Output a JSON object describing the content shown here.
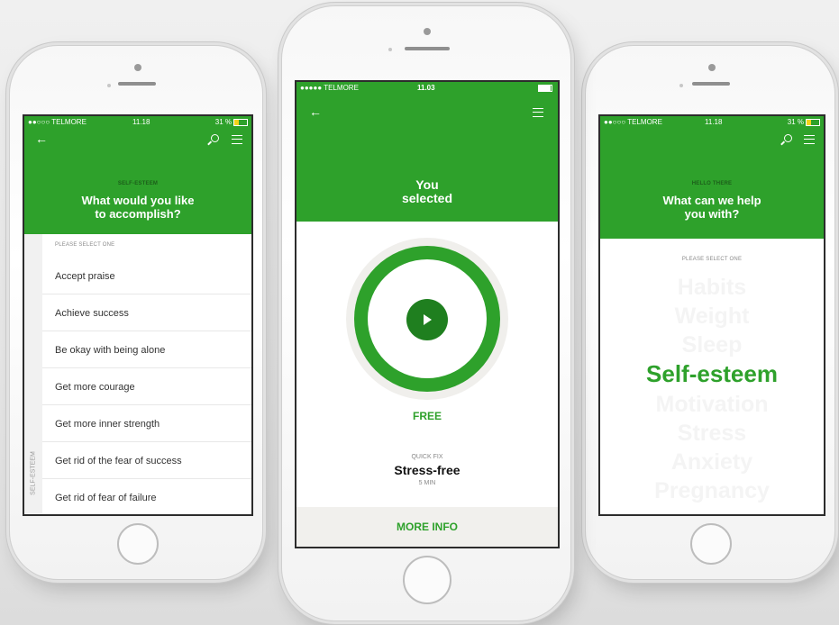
{
  "colors": {
    "brand_green": "#2ea12b",
    "dark_green": "#1f7f1f",
    "faded_word": "#f4f4f4"
  },
  "left_phone": {
    "status": {
      "carrier": "●●○○○ TELMORE",
      "time": "11.18",
      "battery": "31 %"
    },
    "icons": {
      "back": "back-arrow-icon",
      "search": "search-icon",
      "menu": "menu-icon"
    },
    "category": "SELF-ESTEEM",
    "title_line1": "What would you like",
    "title_line2": "to accomplish?",
    "list_header": "PLEASE SELECT ONE",
    "side_label": "SELF-ESTEEM",
    "items": [
      "Accept praise",
      "Achieve success",
      "Be okay with being alone",
      "Get more courage",
      "Get more inner strength",
      "Get rid of the fear of success",
      "Get rid of fear of failure"
    ]
  },
  "center_phone": {
    "status": {
      "carrier": "●●●●● TELMORE",
      "time": "11.03"
    },
    "icons": {
      "back": "back-arrow-icon",
      "menu": "menu-icon",
      "play": "play-icon"
    },
    "title_line1": "You",
    "title_line2": "selected",
    "price": "FREE",
    "session_type": "QUICK FIX",
    "session_name": "Stress-free",
    "duration": "5 MIN",
    "more_info": "MORE INFO"
  },
  "right_phone": {
    "status": {
      "carrier": "●●○○○ TELMORE",
      "time": "11.18",
      "battery": "31 %"
    },
    "icons": {
      "search": "search-icon",
      "menu": "menu-icon"
    },
    "greeting": "HELLO THERE",
    "title_line1": "What can we help",
    "title_line2": "you with?",
    "list_header": "PLEASE SELECT ONE",
    "topics": [
      "Habits",
      "Weight",
      "Sleep",
      "Self-esteem",
      "Motivation",
      "Stress",
      "Anxiety",
      "Pregnancy"
    ],
    "selected_topic": "Self-esteem"
  }
}
